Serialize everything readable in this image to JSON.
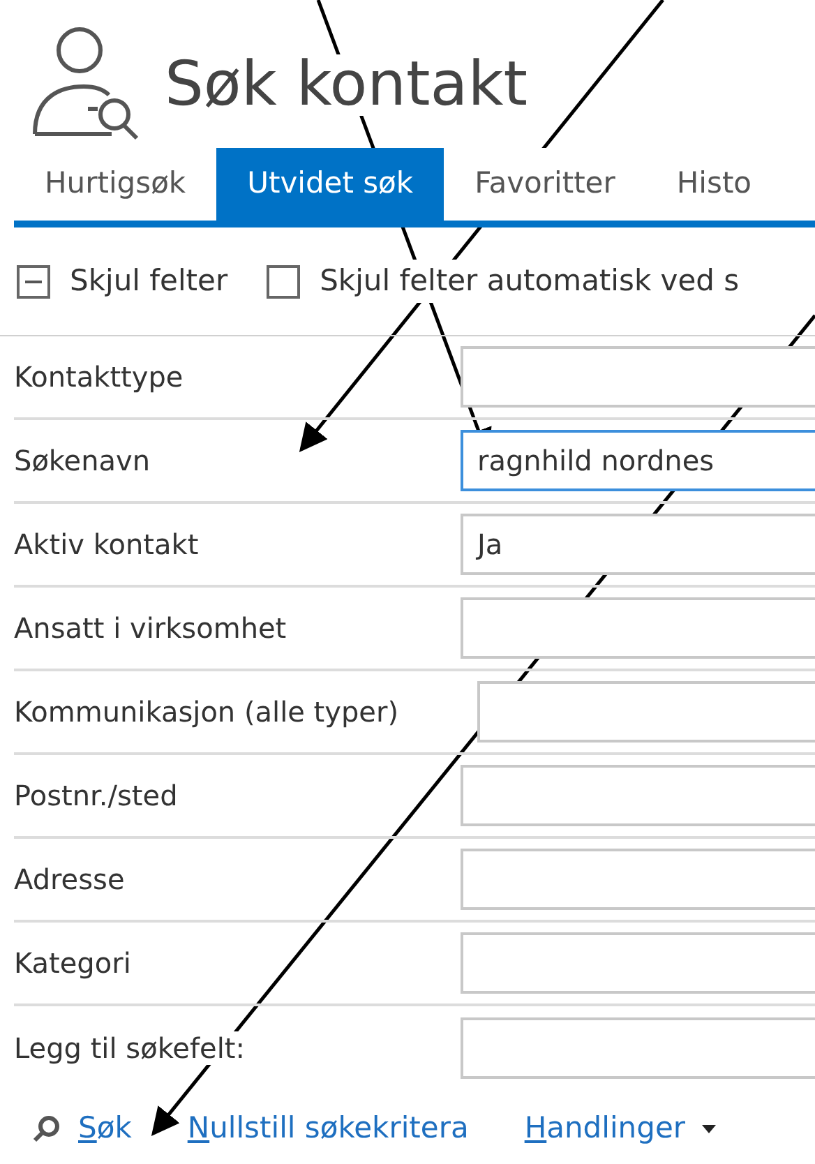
{
  "title": "Søk kontakt",
  "tabs": [
    {
      "label": "Hurtigsøk",
      "selected": false
    },
    {
      "label": "Utvidet søk",
      "selected": true
    },
    {
      "label": "Favoritter",
      "selected": false
    },
    {
      "label": "Histo",
      "selected": false
    }
  ],
  "toggles": [
    {
      "kind": "collapse",
      "label": "Skjul felter"
    },
    {
      "kind": "checkbox",
      "label": "Skjul felter automatisk ved s",
      "checked": false
    }
  ],
  "fields": [
    {
      "label": "Kontakttype",
      "focused": false
    },
    {
      "label": "Søkenavn",
      "value": "ragnhild nordnes",
      "focused": true
    },
    {
      "label": "Aktiv kontakt",
      "value": "Ja",
      "focused": false
    },
    {
      "label": "Ansatt i virksomhet",
      "focused": false
    },
    {
      "label": "Kommunikasjon (alle typer)",
      "focused": false
    },
    {
      "label": "Postnr./sted",
      "focused": false
    },
    {
      "label": "Adresse",
      "focused": false
    },
    {
      "label": "Kategori",
      "focused": false
    },
    {
      "label": "Legg til søkefelt:",
      "focused": false
    }
  ],
  "actions": [
    {
      "kind": "search",
      "label": "Søk"
    },
    {
      "kind": "link",
      "label": "Nullstill søkekritera"
    },
    {
      "kind": "menu",
      "label": "Handlinger"
    }
  ]
}
